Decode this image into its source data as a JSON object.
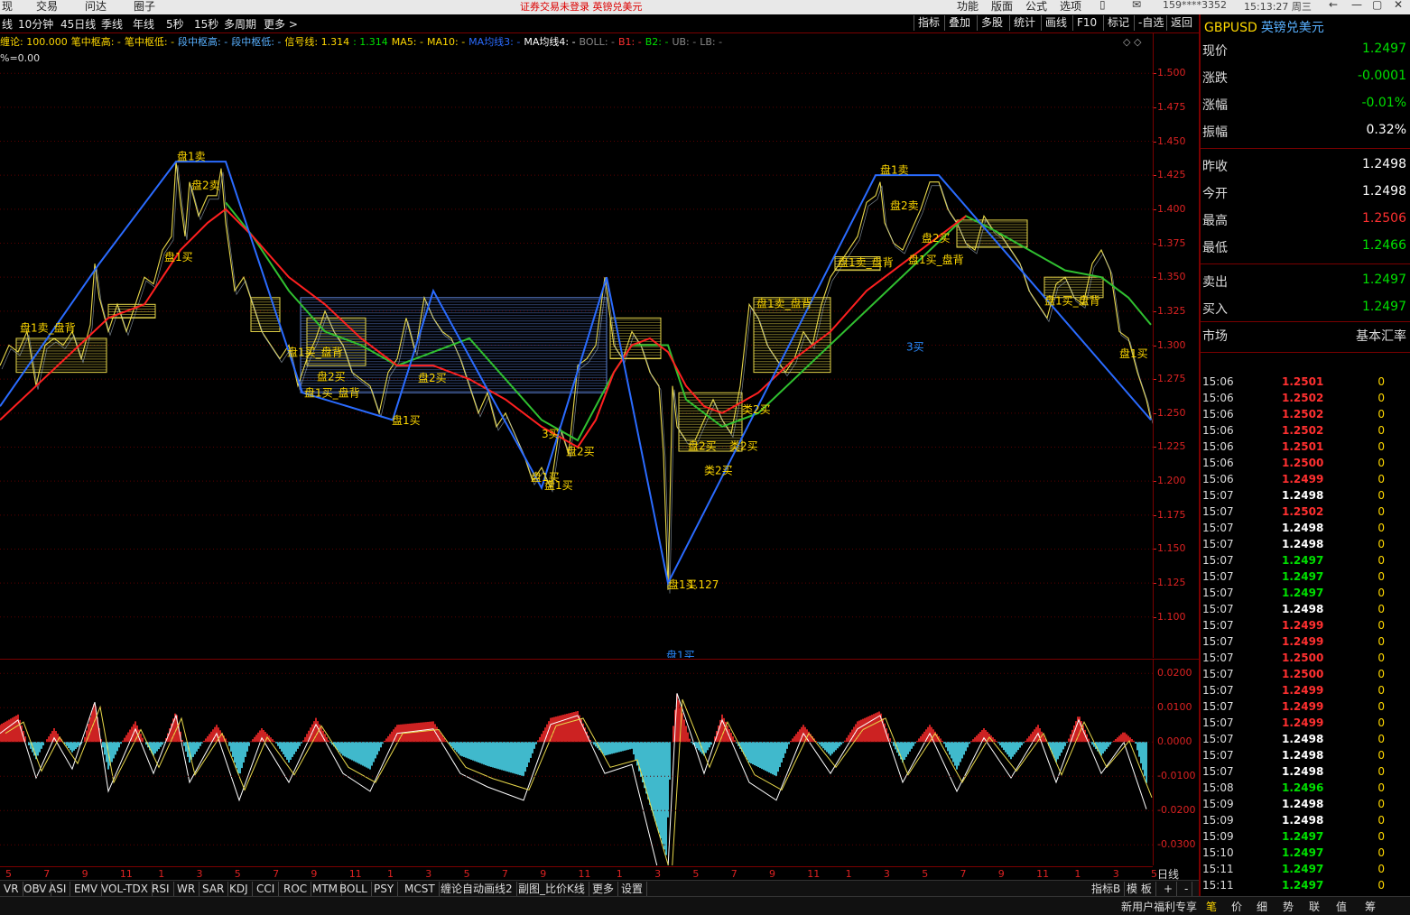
{
  "topbar": {
    "menus": [
      "现",
      "交易",
      "问达",
      "圈子"
    ],
    "notice": "证券交易未登录  英镑兑美元",
    "right_menus": [
      "功能",
      "版面",
      "公式",
      "选项"
    ],
    "user": "159****3352",
    "clock": "15:13:27 周三"
  },
  "periods": [
    "线",
    "10分钟",
    "45日线",
    "季线",
    "年线",
    "5秒",
    "15秒",
    "多周期",
    "更多 >"
  ],
  "tools": [
    "指标",
    "叠加",
    "多股",
    "统计",
    "画线",
    "F10",
    "标记",
    "-自选",
    "返回"
  ],
  "legend": [
    {
      "text": "缠论: 100.000",
      "color": "#ffd800"
    },
    {
      "text": "笔中枢高: -",
      "color": "#ffd800"
    },
    {
      "text": "笔中枢低: -",
      "color": "#ffd800"
    },
    {
      "text": "段中枢高: -",
      "color": "#58b0ff"
    },
    {
      "text": "段中枢低: -",
      "color": "#58b0ff"
    },
    {
      "text": "信号线: 1.314",
      "color": "#ffd800"
    },
    {
      "text": ": 1.314",
      "color": "#00e000"
    },
    {
      "text": "MA5: -",
      "color": "#ffd800"
    },
    {
      "text": "MA10: -",
      "color": "#ffd800"
    },
    {
      "text": "MA均线3: -",
      "color": "#2a6bff"
    },
    {
      "text": "MA均线4: -",
      "color": "#ffffff"
    },
    {
      "text": "BOLL: -",
      "color": "#888888"
    },
    {
      "text": "B1: -",
      "color": "#ff3030"
    },
    {
      "text": "B2: -",
      "color": "#00e000"
    },
    {
      "text": "UB: -",
      "color": "#888888"
    },
    {
      "text": "LB: -",
      "color": "#888888"
    }
  ],
  "sub_legend": "%=0.00",
  "chart_data": {
    "type": "line",
    "title": "GBPUSD 英镑兑美元",
    "y_ticks": [
      "1.500",
      "1.475",
      "1.450",
      "1.425",
      "1.400",
      "1.375",
      "1.350",
      "1.325",
      "1.300",
      "1.275",
      "1.250",
      "1.225",
      "1.200",
      "1.175",
      "1.150",
      "1.125",
      "1.100"
    ],
    "ylim": [
      1.07,
      1.53
    ],
    "price_series": {
      "name": "price",
      "x": [
        0,
        10,
        20,
        30,
        40,
        50,
        60,
        70,
        80,
        90,
        100,
        105,
        110,
        120,
        130,
        140,
        150,
        160,
        170,
        180,
        190,
        195,
        200,
        205,
        210,
        220,
        230,
        240,
        245,
        250,
        255,
        260,
        270,
        280,
        290,
        300,
        310,
        320,
        330,
        340,
        350,
        360,
        370,
        380,
        390,
        400,
        410,
        420,
        430,
        440,
        450,
        460,
        470,
        480,
        490,
        500,
        510,
        520,
        530,
        540,
        550,
        560,
        570,
        580,
        590,
        600,
        610,
        620,
        630,
        640,
        650,
        660,
        670,
        680,
        690,
        700,
        710,
        720,
        730,
        735,
        740,
        745,
        750,
        760,
        770,
        780,
        790,
        800,
        810,
        820,
        830,
        840,
        850,
        860,
        870,
        880,
        890,
        900,
        910,
        920,
        930,
        940,
        950,
        960,
        970,
        975,
        980,
        990,
        1000,
        1010,
        1020,
        1030,
        1040,
        1050,
        1060,
        1070,
        1080,
        1090,
        1100,
        1110,
        1120,
        1130,
        1140,
        1150,
        1160,
        1170,
        1180,
        1190,
        1200,
        1210,
        1220,
        1230,
        1240,
        1250,
        1260,
        1270,
        1275
      ],
      "y": [
        1.285,
        1.3,
        1.295,
        1.31,
        1.27,
        1.3,
        1.305,
        1.3,
        1.31,
        1.29,
        1.315,
        1.36,
        1.335,
        1.31,
        1.33,
        1.31,
        1.33,
        1.35,
        1.345,
        1.37,
        1.38,
        1.435,
        1.405,
        1.38,
        1.42,
        1.395,
        1.41,
        1.41,
        1.43,
        1.39,
        1.365,
        1.34,
        1.35,
        1.33,
        1.31,
        1.3,
        1.29,
        1.3,
        1.27,
        1.29,
        1.305,
        1.325,
        1.31,
        1.3,
        1.28,
        1.275,
        1.27,
        1.25,
        1.28,
        1.29,
        1.32,
        1.295,
        1.335,
        1.32,
        1.31,
        1.305,
        1.29,
        1.27,
        1.25,
        1.265,
        1.24,
        1.25,
        1.235,
        1.22,
        1.2,
        1.21,
        1.195,
        1.24,
        1.22,
        1.285,
        1.29,
        1.3,
        1.35,
        1.3,
        1.29,
        1.31,
        1.3,
        1.28,
        1.27,
        1.22,
        1.12,
        1.27,
        1.24,
        1.23,
        1.23,
        1.245,
        1.26,
        1.245,
        1.235,
        1.27,
        1.33,
        1.32,
        1.3,
        1.29,
        1.28,
        1.29,
        1.31,
        1.3,
        1.33,
        1.35,
        1.36,
        1.37,
        1.38,
        1.405,
        1.41,
        1.42,
        1.39,
        1.375,
        1.37,
        1.385,
        1.4,
        1.42,
        1.42,
        1.4,
        1.39,
        1.375,
        1.37,
        1.395,
        1.385,
        1.38,
        1.37,
        1.36,
        1.34,
        1.33,
        1.32,
        1.345,
        1.35,
        1.335,
        1.33,
        1.36,
        1.37,
        1.355,
        1.31,
        1.305,
        1.28,
        1.26,
        1.245
      ]
    },
    "stroke_series": {
      "name": "笔",
      "x": [
        0,
        110,
        195,
        250,
        335,
        435,
        480,
        600,
        672,
        740,
        970,
        1040,
        1275
      ],
      "y": [
        1.255,
        1.36,
        1.435,
        1.435,
        1.265,
        1.245,
        1.34,
        1.195,
        1.35,
        1.125,
        1.425,
        1.425,
        1.245
      ]
    },
    "ma_red": {
      "name": "MA-red",
      "x": [
        0,
        40,
        80,
        120,
        160,
        200,
        230,
        250,
        280,
        320,
        360,
        400,
        440,
        480,
        520,
        560,
        600,
        640,
        660,
        680,
        700,
        720,
        740,
        760,
        780,
        800,
        840,
        880,
        920,
        960,
        1000,
        1040,
        1070
      ],
      "y": [
        1.245,
        1.27,
        1.295,
        1.32,
        1.33,
        1.37,
        1.39,
        1.4,
        1.38,
        1.35,
        1.33,
        1.305,
        1.285,
        1.285,
        1.275,
        1.26,
        1.24,
        1.225,
        1.245,
        1.28,
        1.3,
        1.305,
        1.295,
        1.27,
        1.255,
        1.25,
        1.265,
        1.29,
        1.31,
        1.34,
        1.36,
        1.38,
        1.395
      ]
    },
    "ma_green": {
      "name": "MA-green",
      "x": [
        250,
        280,
        320,
        360,
        400,
        440,
        480,
        520,
        560,
        600,
        640,
        680,
        700,
        720,
        740,
        760,
        780,
        800,
        840,
        1070,
        1100,
        1140,
        1180,
        1220,
        1250,
        1275
      ],
      "y": [
        1.405,
        1.38,
        1.34,
        1.31,
        1.3,
        1.285,
        1.295,
        1.305,
        1.275,
        1.245,
        1.23,
        1.28,
        1.3,
        1.3,
        1.3,
        1.26,
        1.25,
        1.24,
        1.25,
        1.395,
        1.385,
        1.37,
        1.355,
        1.35,
        1.335,
        1.315
      ]
    },
    "boxes": [
      {
        "x0": 333,
        "x1": 672,
        "y0": 1.265,
        "y1": 1.335,
        "color": "#5a7fd0"
      },
      {
        "x0": 18,
        "x1": 118,
        "y0": 1.28,
        "y1": 1.305,
        "color": "#e8d84a"
      },
      {
        "x0": 120,
        "x1": 172,
        "y0": 1.32,
        "y1": 1.33,
        "color": "#e8d84a"
      },
      {
        "x0": 278,
        "x1": 310,
        "y0": 1.31,
        "y1": 1.335,
        "color": "#e8d84a"
      },
      {
        "x0": 340,
        "x1": 405,
        "y0": 1.285,
        "y1": 1.32,
        "color": "#e8d84a"
      },
      {
        "x0": 676,
        "x1": 732,
        "y0": 1.29,
        "y1": 1.32,
        "color": "#e8d84a"
      },
      {
        "x0": 752,
        "x1": 822,
        "y0": 1.222,
        "y1": 1.265,
        "color": "#e8d84a"
      },
      {
        "x0": 835,
        "x1": 920,
        "y0": 1.28,
        "y1": 1.335,
        "color": "#e8d84a"
      },
      {
        "x0": 925,
        "x1": 975,
        "y0": 1.355,
        "y1": 1.365,
        "color": "#e8d84a"
      },
      {
        "x0": 1060,
        "x1": 1138,
        "y0": 1.372,
        "y1": 1.392,
        "color": "#e8d84a"
      },
      {
        "x0": 1157,
        "x1": 1222,
        "y0": 1.335,
        "y1": 1.35,
        "color": "#e8d84a"
      }
    ],
    "annotations": [
      {
        "x": 196,
        "y": 1.436,
        "text": "盘1卖",
        "color": "#ffd800"
      },
      {
        "x": 212,
        "y": 1.415,
        "text": "盘2卖",
        "color": "#ffd800"
      },
      {
        "x": 182,
        "y": 1.362,
        "text": "盘1买",
        "color": "#ffd800"
      },
      {
        "x": 22,
        "y": 1.31,
        "text": "盘1卖_盘背",
        "color": "#ffd800"
      },
      {
        "x": 318,
        "y": 1.292,
        "text": "盘1买_盘背",
        "color": "#ffd800"
      },
      {
        "x": 351,
        "y": 1.274,
        "text": "盘2买",
        "color": "#ffd800"
      },
      {
        "x": 337,
        "y": 1.262,
        "text": "盘1买_盘背",
        "color": "#ffd800"
      },
      {
        "x": 463,
        "y": 1.273,
        "text": "盘2买",
        "color": "#ffd800"
      },
      {
        "x": 434,
        "y": 1.242,
        "text": "盘1买",
        "color": "#ffd800"
      },
      {
        "x": 600,
        "y": 1.232,
        "text": "3买",
        "color": "#ffd800"
      },
      {
        "x": 627,
        "y": 1.219,
        "text": "盘2买",
        "color": "#ffd800"
      },
      {
        "x": 588,
        "y": 1.2,
        "text": "盘1买",
        "color": "#ffd800"
      },
      {
        "x": 603,
        "y": 1.194,
        "text": "盘1买",
        "color": "#ffd800"
      },
      {
        "x": 740,
        "y": 1.121,
        "text": "盘1买",
        "color": "#ffd800"
      },
      {
        "x": 762,
        "y": 1.121,
        "text": "1.127",
        "color": "#ffd800"
      },
      {
        "x": 738,
        "y": 1.069,
        "text": "盘1买",
        "color": "#2a8bff"
      },
      {
        "x": 762,
        "y": 1.223,
        "text": "盘2买",
        "color": "#ffd800"
      },
      {
        "x": 780,
        "y": 1.205,
        "text": "类2买",
        "color": "#ffd800"
      },
      {
        "x": 808,
        "y": 1.223,
        "text": "类2买",
        "color": "#ffd800"
      },
      {
        "x": 822,
        "y": 1.25,
        "text": "类2买",
        "color": "#ffd800"
      },
      {
        "x": 838,
        "y": 1.328,
        "text": "盘1卖_盘背",
        "color": "#ffd800"
      },
      {
        "x": 928,
        "y": 1.358,
        "text": "盘1卖_盘背",
        "color": "#ffd800"
      },
      {
        "x": 975,
        "y": 1.426,
        "text": "盘1卖",
        "color": "#ffd800"
      },
      {
        "x": 986,
        "y": 1.4,
        "text": "盘2卖",
        "color": "#ffd800"
      },
      {
        "x": 1021,
        "y": 1.376,
        "text": "盘2买",
        "color": "#ffd800"
      },
      {
        "x": 1006,
        "y": 1.36,
        "text": "盘1买_盘背",
        "color": "#ffd800"
      },
      {
        "x": 1004,
        "y": 1.296,
        "text": "3买",
        "color": "#2a8bff"
      },
      {
        "x": 1157,
        "y": 1.33,
        "text": "盘1买_盘背",
        "color": "#ffd800"
      },
      {
        "x": 1240,
        "y": 1.291,
        "text": "盘1买",
        "color": "#ffd800"
      }
    ]
  },
  "indicator": {
    "y_ticks": [
      "0.0200",
      "0.0100",
      "0.0000",
      "-0.0100",
      "-0.0200",
      "-0.0300"
    ],
    "ylim": [
      -0.036,
      0.024
    ],
    "macd_points": [
      {
        "x": 0,
        "v": 0.005
      },
      {
        "x": 20,
        "v": 0.008
      },
      {
        "x": 40,
        "v": -0.005
      },
      {
        "x": 60,
        "v": 0.004
      },
      {
        "x": 80,
        "v": -0.003
      },
      {
        "x": 105,
        "v": 0.012
      },
      {
        "x": 120,
        "v": -0.008
      },
      {
        "x": 150,
        "v": 0.006
      },
      {
        "x": 170,
        "v": -0.004
      },
      {
        "x": 195,
        "v": 0.009
      },
      {
        "x": 210,
        "v": -0.006
      },
      {
        "x": 240,
        "v": 0.005
      },
      {
        "x": 265,
        "v": -0.01
      },
      {
        "x": 290,
        "v": 0.004
      },
      {
        "x": 320,
        "v": -0.006
      },
      {
        "x": 350,
        "v": 0.007
      },
      {
        "x": 380,
        "v": -0.004
      },
      {
        "x": 410,
        "v": -0.008
      },
      {
        "x": 440,
        "v": 0.005
      },
      {
        "x": 480,
        "v": 0.006
      },
      {
        "x": 510,
        "v": -0.004
      },
      {
        "x": 540,
        "v": -0.007
      },
      {
        "x": 580,
        "v": -0.01
      },
      {
        "x": 610,
        "v": 0.007
      },
      {
        "x": 640,
        "v": 0.009
      },
      {
        "x": 670,
        "v": -0.004
      },
      {
        "x": 700,
        "v": -0.002
      },
      {
        "x": 738,
        "v": -0.033
      },
      {
        "x": 750,
        "v": 0.014
      },
      {
        "x": 780,
        "v": -0.004
      },
      {
        "x": 800,
        "v": 0.008
      },
      {
        "x": 830,
        "v": -0.006
      },
      {
        "x": 860,
        "v": -0.01
      },
      {
        "x": 890,
        "v": 0.005
      },
      {
        "x": 920,
        "v": -0.004
      },
      {
        "x": 950,
        "v": 0.006
      },
      {
        "x": 975,
        "v": 0.009
      },
      {
        "x": 1000,
        "v": -0.006
      },
      {
        "x": 1030,
        "v": 0.005
      },
      {
        "x": 1060,
        "v": -0.008
      },
      {
        "x": 1090,
        "v": 0.004
      },
      {
        "x": 1120,
        "v": -0.005
      },
      {
        "x": 1150,
        "v": 0.005
      },
      {
        "x": 1170,
        "v": -0.006
      },
      {
        "x": 1195,
        "v": 0.008
      },
      {
        "x": 1220,
        "v": -0.004
      },
      {
        "x": 1245,
        "v": 0.003
      },
      {
        "x": 1270,
        "v": -0.012
      }
    ]
  },
  "date_labels": [
    "5",
    "7",
    "9",
    "11",
    "1",
    "3",
    "5",
    "7",
    "9",
    "11",
    "1",
    "3",
    "5",
    "7",
    "9",
    "11",
    "1",
    "3",
    "5",
    "7",
    "9",
    "11",
    "1",
    "3",
    "5",
    "7",
    "9",
    "11",
    "1",
    "3",
    "5"
  ],
  "period_button": "日线",
  "tabs": [
    "VR",
    "OBV",
    "ASI",
    "EMV",
    "VOL-TDX",
    "RSI",
    "WR",
    "SAR",
    "KDJ",
    "CCI",
    "ROC",
    "MTM",
    "BOLL",
    "PSY",
    "MCST",
    "缠论自动画线2",
    "副图_比价K线",
    "更多",
    "设置"
  ],
  "tabs_right": [
    "指标B",
    "模 板",
    "+",
    "-"
  ],
  "quote": {
    "symbol": "GBPUSD",
    "name": "英镑兑美元",
    "rows1": [
      {
        "k": "现价",
        "v": "1.2497",
        "c": "#00e000"
      },
      {
        "k": "涨跌",
        "v": "-0.0001",
        "c": "#00e000"
      },
      {
        "k": "涨幅",
        "v": "-0.01%",
        "c": "#00e000"
      },
      {
        "k": "振幅",
        "v": "0.32%",
        "c": "#ffffff"
      }
    ],
    "rows2": [
      {
        "k": "昨收",
        "v": "1.2498",
        "c": "#ffffff"
      },
      {
        "k": "今开",
        "v": "1.2498",
        "c": "#ffffff"
      },
      {
        "k": "最高",
        "v": "1.2506",
        "c": "#ff3030"
      },
      {
        "k": "最低",
        "v": "1.2466",
        "c": "#00e000"
      }
    ],
    "rows3": [
      {
        "k": "卖出",
        "v": "1.2497",
        "c": "#00e000"
      },
      {
        "k": "买入",
        "v": "1.2497",
        "c": "#00e000"
      }
    ],
    "market": {
      "k": "市场",
      "v": "基本汇率"
    }
  },
  "ticks": [
    {
      "t": "15:06",
      "p": "1.2501",
      "c": "#ff3030",
      "v": "0"
    },
    {
      "t": "15:06",
      "p": "1.2502",
      "c": "#ff3030",
      "v": "0"
    },
    {
      "t": "15:06",
      "p": "1.2502",
      "c": "#ff3030",
      "v": "0"
    },
    {
      "t": "15:06",
      "p": "1.2502",
      "c": "#ff3030",
      "v": "0"
    },
    {
      "t": "15:06",
      "p": "1.2501",
      "c": "#ff3030",
      "v": "0"
    },
    {
      "t": "15:06",
      "p": "1.2500",
      "c": "#ff3030",
      "v": "0"
    },
    {
      "t": "15:06",
      "p": "1.2499",
      "c": "#ff3030",
      "v": "0"
    },
    {
      "t": "15:07",
      "p": "1.2498",
      "c": "#ffffff",
      "v": "0"
    },
    {
      "t": "15:07",
      "p": "1.2502",
      "c": "#ff3030",
      "v": "0"
    },
    {
      "t": "15:07",
      "p": "1.2498",
      "c": "#ffffff",
      "v": "0"
    },
    {
      "t": "15:07",
      "p": "1.2498",
      "c": "#ffffff",
      "v": "0"
    },
    {
      "t": "15:07",
      "p": "1.2497",
      "c": "#00e000",
      "v": "0"
    },
    {
      "t": "15:07",
      "p": "1.2497",
      "c": "#00e000",
      "v": "0"
    },
    {
      "t": "15:07",
      "p": "1.2497",
      "c": "#00e000",
      "v": "0"
    },
    {
      "t": "15:07",
      "p": "1.2498",
      "c": "#ffffff",
      "v": "0"
    },
    {
      "t": "15:07",
      "p": "1.2499",
      "c": "#ff3030",
      "v": "0"
    },
    {
      "t": "15:07",
      "p": "1.2499",
      "c": "#ff3030",
      "v": "0"
    },
    {
      "t": "15:07",
      "p": "1.2500",
      "c": "#ff3030",
      "v": "0"
    },
    {
      "t": "15:07",
      "p": "1.2500",
      "c": "#ff3030",
      "v": "0"
    },
    {
      "t": "15:07",
      "p": "1.2499",
      "c": "#ff3030",
      "v": "0"
    },
    {
      "t": "15:07",
      "p": "1.2499",
      "c": "#ff3030",
      "v": "0"
    },
    {
      "t": "15:07",
      "p": "1.2499",
      "c": "#ff3030",
      "v": "0"
    },
    {
      "t": "15:07",
      "p": "1.2498",
      "c": "#ffffff",
      "v": "0"
    },
    {
      "t": "15:07",
      "p": "1.2498",
      "c": "#ffffff",
      "v": "0"
    },
    {
      "t": "15:07",
      "p": "1.2498",
      "c": "#ffffff",
      "v": "0"
    },
    {
      "t": "15:08",
      "p": "1.2496",
      "c": "#00e000",
      "v": "0"
    },
    {
      "t": "15:09",
      "p": "1.2498",
      "c": "#ffffff",
      "v": "0"
    },
    {
      "t": "15:09",
      "p": "1.2498",
      "c": "#ffffff",
      "v": "0"
    },
    {
      "t": "15:09",
      "p": "1.2497",
      "c": "#00e000",
      "v": "0"
    },
    {
      "t": "15:10",
      "p": "1.2497",
      "c": "#00e000",
      "v": "0"
    },
    {
      "t": "15:11",
      "p": "1.2497",
      "c": "#00e000",
      "v": "0"
    },
    {
      "t": "15:11",
      "p": "1.2497",
      "c": "#00e000",
      "v": "0"
    }
  ],
  "status": [
    "新用户福利专享",
    "笔",
    "价",
    "细",
    "势",
    "联",
    "值",
    "筹"
  ]
}
